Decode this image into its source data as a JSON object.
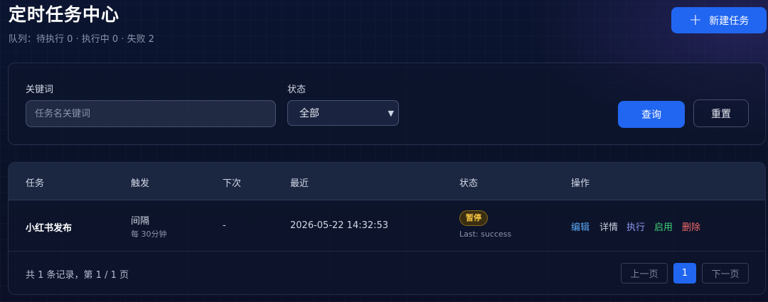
{
  "header": {
    "title": "定时任务中心",
    "queue_status": "队列：待执行 0 · 执行中 0 · 失败 2",
    "new_task_label": "新建任务"
  },
  "filter": {
    "keyword_label": "关键词",
    "keyword_placeholder": "任务名关键词",
    "keyword_value": "",
    "status_label": "状态",
    "status_selected": "全部",
    "query_label": "查询",
    "reset_label": "重置"
  },
  "table": {
    "columns": [
      "任务",
      "触发",
      "下次",
      "最近",
      "状态",
      "操作"
    ],
    "rows": [
      {
        "task": "小红书发布",
        "trigger": "间隔",
        "trigger_detail": "每 30分钟",
        "next": "-",
        "last": "2026-05-22 14:32:53",
        "status_badge": "暂停",
        "status_detail": "Last: success",
        "actions": {
          "edit": "编辑",
          "detail": "详情",
          "run": "执行",
          "enable": "启用",
          "delete": "删除"
        }
      }
    ]
  },
  "pagination": {
    "summary": "共 1 条记录，第 1 / 1 页",
    "prev_label": "上一页",
    "current_page": "1",
    "next_label": "下一页"
  },
  "colors": {
    "primary": "#2166f0",
    "badge_paused": "#f5c542",
    "action_edit": "#5ba8f5",
    "action_detail": "#c9cfdd",
    "action_run": "#8f9bf5",
    "action_enable": "#3ed17a",
    "action_delete": "#f26a6a"
  },
  "icons": {
    "new_task": "plus-icon",
    "select": "chevron-down-icon"
  }
}
